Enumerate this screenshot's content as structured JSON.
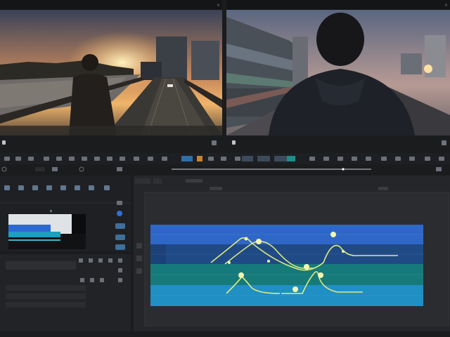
{
  "left_monitor": {
    "title": "",
    "close_icon": "×"
  },
  "right_monitor": {
    "title": "",
    "close_icon": "×"
  },
  "icons": {
    "play": "play-icon",
    "search": "search-icon",
    "gear": "gear-icon"
  },
  "colors": {
    "background": "#1b1c1e",
    "panel": "#202124",
    "accent_blue": "#2f6fd6",
    "accent_cyan": "#1fa3c4",
    "teal": "#17807a",
    "curve": "#e8f27a"
  }
}
